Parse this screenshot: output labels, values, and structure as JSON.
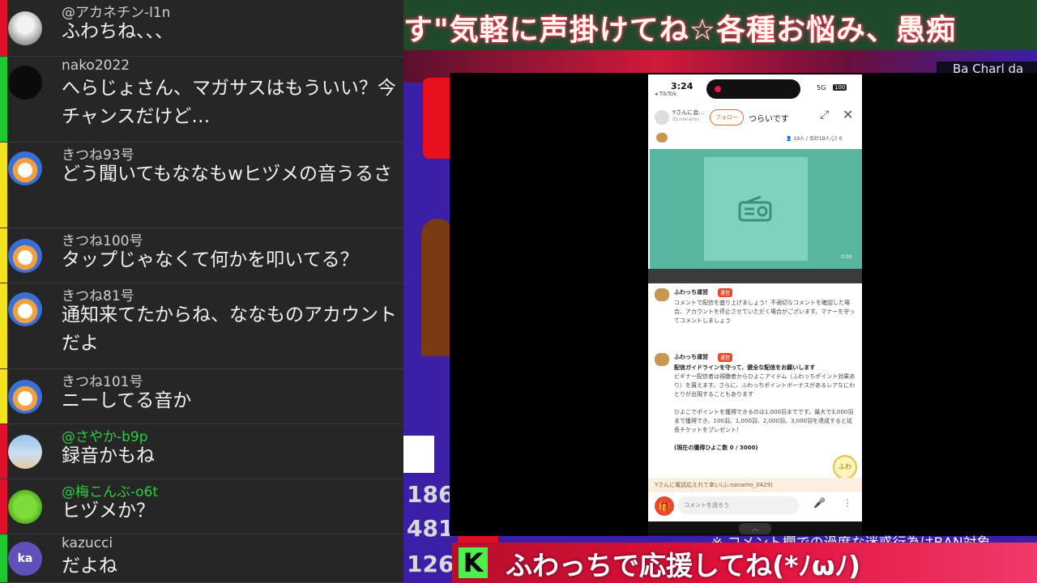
{
  "chat": {
    "messages": [
      {
        "user": "@アカネチン-l1n",
        "text": "ふわちね、、、",
        "bar": "#e0102a",
        "user_color": "#cfcfcf",
        "avatar": "rabbit-avatar"
      },
      {
        "user": "nako2022",
        "text": "へらじょさん、マガサスはもういい？今チャンスだけど…",
        "bar": "#1ec82f",
        "user_color": "#cfcfcf",
        "avatar": "dark-avatar"
      },
      {
        "user": "きつね93号",
        "text": "どう聞いてもななもwヒヅメの音うるさ",
        "bar": "#f2e320",
        "user_color": "#cfcfcf",
        "avatar": "hamster-avatar"
      },
      {
        "user": "きつね100号",
        "text": "タップじゃなくて何かを叩いてる？",
        "bar": "#f2e320",
        "user_color": "#cfcfcf",
        "avatar": "hamster-avatar"
      },
      {
        "user": "きつね81号",
        "text": "通知来てたからね、ななものアカウントだよ",
        "bar": "#f2e320",
        "user_color": "#cfcfcf",
        "avatar": "hamster-avatar"
      },
      {
        "user": "きつね101号",
        "text": "ニーしてる音か",
        "bar": "#f2e320",
        "user_color": "#cfcfcf",
        "avatar": "hamster-avatar"
      },
      {
        "user": "@さやか-b9p",
        "text": "録音かもね",
        "bar": "#e0102a",
        "user_color": "#2ecc40",
        "avatar": "sky-avatar"
      },
      {
        "user": "@梅こんぶ-o6t",
        "text": "ヒヅメか？",
        "bar": "#e0102a",
        "user_color": "#2ecc40",
        "avatar": "frog-avatar"
      },
      {
        "user": "kazucci",
        "text": "だよね",
        "bar": "#1ec82f",
        "user_color": "#cfcfcf",
        "avatar": "ka-avatar",
        "initials": "ka"
      }
    ]
  },
  "stream": {
    "banner": "す\"気軽に声掛けてね☆各種お悩み、愚痴",
    "top_right": "Ba Charl da",
    "stats": [
      "186",
      "481",
      "126"
    ],
    "ticker": "※ コメント欄での過度な迷惑行為はBAN対象",
    "footer_logo": "K",
    "footer": "ふわっちで応援してね(*ﾉωﾉ)"
  },
  "phone": {
    "time": "3:24",
    "back_label": "◂ TikTok",
    "network": "5G",
    "battery": "100",
    "host_name": "Yさんに会…",
    "host_sub": "ID:nanamo",
    "follow": "フォロー",
    "room_title": "つらいです",
    "counts": "👤 19人 / 合計19人  💬 0",
    "video_time": "0:00",
    "sys1": {
      "name": "ふわっち運営",
      "badge": "運営",
      "body": "コメントで配信を盛り上げましょう！不適切なコメントを確認した場合、アカウントを停止させていただく場合がございます。マナーを守ってコメントしましょう"
    },
    "sys2": {
      "name": "ふわっち運営",
      "badge": "運営",
      "heading": "配信ガイドラインを守って、健全な配信をお願いします",
      "body": "ビギナー配信者は視聴者からひよこアイテム（ふわっちポイント効果あり）を貰えます。さらに、ふわっちポイントボーナスがあるレアなにわとりが出現することもあります",
      "body2": "ひよこでポイントを獲得できるのは1,000羽までです。最大で3,000羽まで獲得でき、100羽、1,000羽、2,000羽、3,000羽を達成すると延長チケットをプレゼント！",
      "progress": "(現在の獲得ひよこ数 0 / 3000)"
    },
    "thanks": "Yさんに電話応えれて幸い(ふ:nanamo_0429)",
    "input_placeholder": "コメントを送ろう",
    "mascot": "ふわ"
  }
}
